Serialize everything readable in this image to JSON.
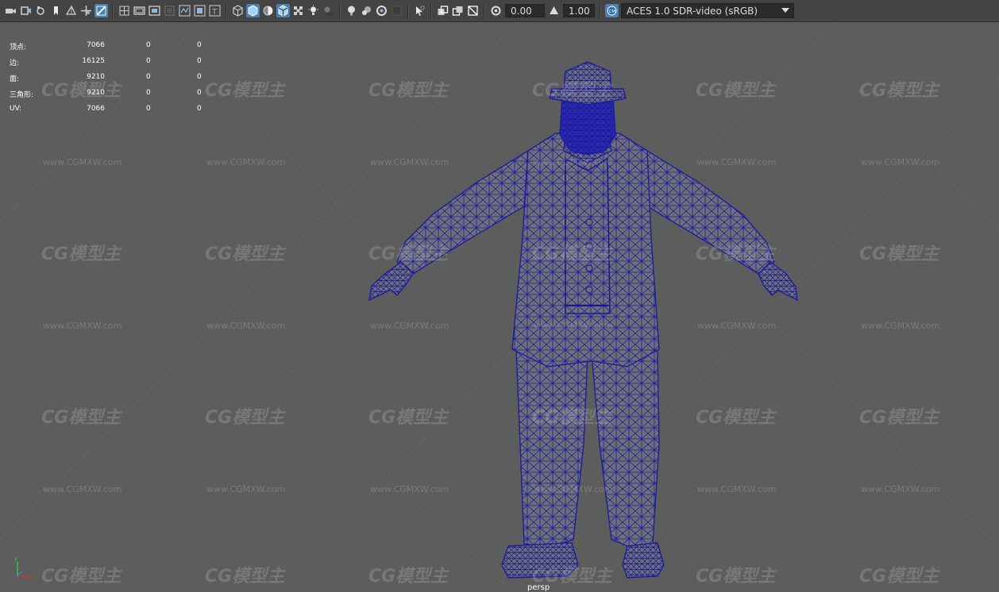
{
  "toolbar": {
    "exposure_value": "0.00",
    "gamma_value": "1.00",
    "color_space": "ACES 1.0 SDR-video (sRGB)",
    "icons": [
      "camera-icon",
      "camera-attributes-icon",
      "bookmark-icon",
      "image-plane-icon",
      "grid-icon",
      "film-gate-icon",
      "resolution-gate-icon",
      "field-chart-icon",
      "safe-action-icon",
      "safe-title-icon",
      "wireframe-icon",
      "smooth-shade-icon",
      "default-material-icon",
      "wireframe-on-shaded-icon",
      "xray-icon",
      "lights-icon",
      "shadows-icon",
      "ambient-occlusion-icon",
      "motion-blur-icon",
      "anti-aliasing-icon",
      "isolate-select-icon",
      "xray-joints-icon",
      "backface-icon",
      "exposure-icon",
      "gamma-icon",
      "color-management-icon"
    ]
  },
  "hud": {
    "rows": [
      {
        "label": "顶点:",
        "v1": "7066",
        "v2": "0",
        "v3": "0"
      },
      {
        "label": "边:",
        "v1": "16125",
        "v2": "0",
        "v3": "0"
      },
      {
        "label": "面:",
        "v1": "9210",
        "v2": "0",
        "v3": "0"
      },
      {
        "label": "三角形:",
        "v1": "9210",
        "v2": "0",
        "v3": "0"
      },
      {
        "label": "UV:",
        "v1": "7066",
        "v2": "0",
        "v3": "0"
      }
    ]
  },
  "watermark": {
    "logo_text": "CG模型主",
    "url_text": "www.CGMXW.com"
  },
  "viewport": {
    "camera_name": "persp"
  },
  "colors": {
    "wire": "#1e1e9a",
    "mesh_fill": "#6e6f78",
    "viewport_bg": "#5d5d5d",
    "accent": "#4a7fb0"
  }
}
